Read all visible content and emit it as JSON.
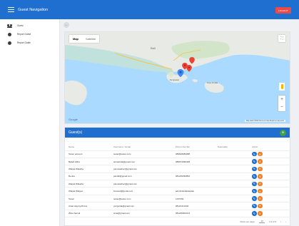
{
  "header": {
    "title": "Guest Navigation",
    "logout_label": "LOGOUT"
  },
  "sidebar": {
    "items": [
      {
        "label": "Guest",
        "icon": "users-icon"
      },
      {
        "label": "Report Guest",
        "icon": "circle-icon"
      },
      {
        "label": "Report Guide",
        "icon": "circle-icon"
      }
    ]
  },
  "map": {
    "tabs": [
      "Map",
      "Satellite"
    ],
    "active_tab": "Map",
    "city_labels": [
      "Denpasar",
      "Bali",
      "Nusa Penida"
    ],
    "attribution": "Map data ©2020  Terms of Use  Report a map error",
    "logo": "Google"
  },
  "guests": {
    "title": "Guest(s)",
    "columns": [
      "Name",
      "Username / Email",
      "Phone Number",
      "Nationality",
      "Action"
    ],
    "rows": [
      [
        "Tester account",
        "tester@tester.com",
        "089628083088",
        "",
        ""
      ],
      [
        "Bellah Altha",
        "amaetrida@gmail.com",
        "089672096428",
        "",
        ""
      ],
      [
        "Walpat Walatha",
        "pamewaheri@gmail.com",
        "",
        "",
        ""
      ],
      [
        "Renita",
        "pandki@gmail.com",
        "081236290893",
        "",
        ""
      ],
      [
        "Walpat Walatha",
        "pamewaheri@gmail.com",
        "",
        "",
        ""
      ],
      [
        "Walpat Walgus",
        "bnowarl@gmail.com",
        "adminitaralaitaralan",
        "",
        ""
      ],
      [
        "Tester",
        "tester@tester.com",
        "1237291",
        "",
        ""
      ],
      [
        "Antai Hayruyd'hima",
        "yozgarda@gmail.com",
        "08121212334",
        "",
        ""
      ],
      [
        "Wina Samal",
        "wina@gmail.com",
        "081236902314",
        "",
        ""
      ]
    ],
    "pagination": {
      "rows_per_page_label": "Rows per page:",
      "rows_per_page": "10",
      "range": "1-9 of 9",
      "prev": "‹",
      "next": "›"
    }
  },
  "colors": {
    "primary": "#1f6fd1",
    "logout": "#e94b4b",
    "edit": "#1f6fd1",
    "delete": "#f57c1f",
    "add": "#43a047"
  }
}
